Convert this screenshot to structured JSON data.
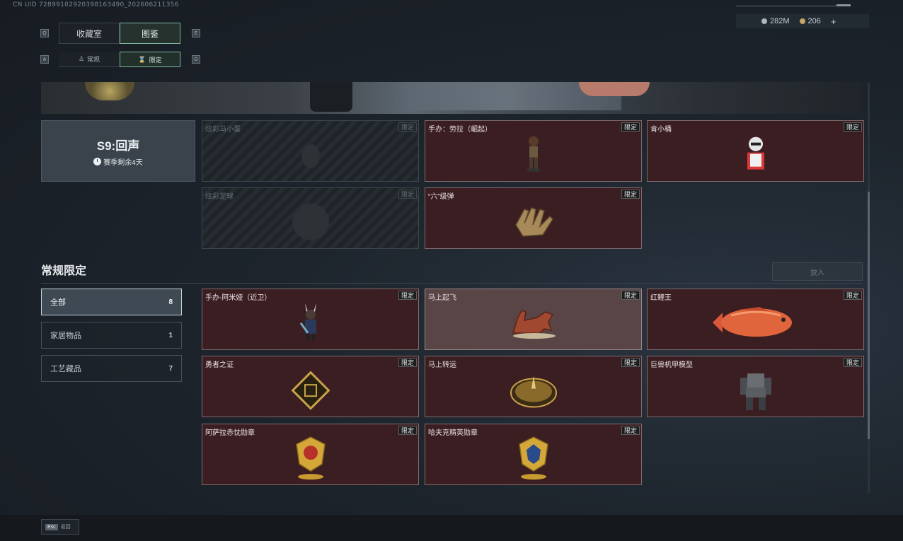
{
  "uid": "CN UID 7289910292039816349​0_202606211356",
  "tabs": {
    "key_left": "Q",
    "key_right": "E",
    "items": [
      "收藏室",
      "图鉴"
    ],
    "active": 1
  },
  "subtabs": {
    "key_left": "A",
    "key_right": "D",
    "items": [
      "常规",
      "限定"
    ],
    "active": 1
  },
  "currency": {
    "primary": "282M",
    "secondary": "206",
    "add": "+"
  },
  "season": {
    "title": "S9:回声",
    "subtitle": "赛季剩余4天"
  },
  "season_items": [
    {
      "name": "炫彩马小蛋",
      "tag": "限定",
      "locked": true
    },
    {
      "name": "手办：劳拉（崛起）",
      "tag": "限定",
      "locked": false
    },
    {
      "name": "肯小桶",
      "tag": "限定",
      "locked": false
    },
    {
      "name": "炫彩足球",
      "tag": "限定",
      "locked": true
    },
    {
      "name": "“六”级弹",
      "tag": "限定",
      "locked": false
    }
  ],
  "section": {
    "title": "常规限定",
    "place_button": "放入"
  },
  "filters": [
    {
      "label": "全部",
      "count": "8"
    },
    {
      "label": "家居物品",
      "count": "1"
    },
    {
      "label": "工艺藏品",
      "count": "7"
    }
  ],
  "regular_items": [
    {
      "name": "手办-阿米娅（近卫）",
      "tag": "限定"
    },
    {
      "name": "马上起飞",
      "tag": "限定"
    },
    {
      "name": "红鲤王",
      "tag": "限定"
    },
    {
      "name": "勇者之证",
      "tag": "限定"
    },
    {
      "name": "马上转运",
      "tag": "限定"
    },
    {
      "name": "巨兽机甲模型",
      "tag": "限定"
    },
    {
      "name": "阿萨拉赤忱勋章",
      "tag": "限定"
    },
    {
      "name": "哈夫克精英勋章",
      "tag": "限定"
    }
  ],
  "footer": {
    "esc_key": "Esc",
    "esc_label": "返回"
  },
  "colors": {
    "accent": "#7fb59d",
    "card_bg": "#3b1e22",
    "card_border": "#7e6a6c"
  }
}
